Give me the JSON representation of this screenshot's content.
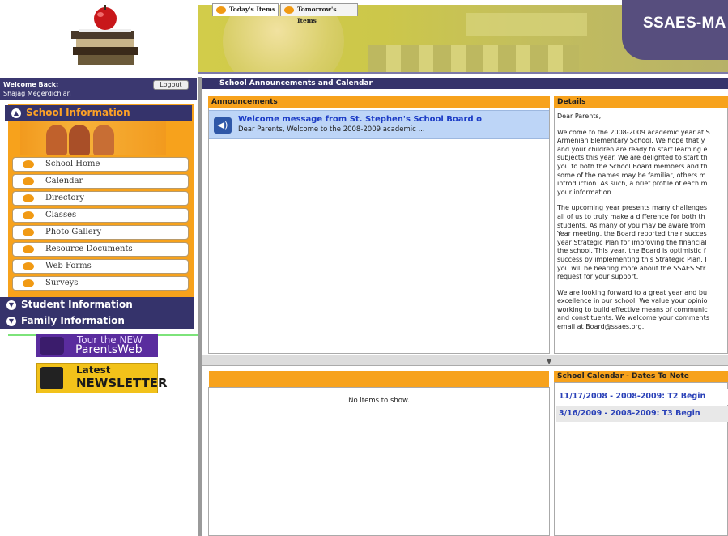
{
  "header": {
    "brand": "SSAES-MA"
  },
  "user": {
    "welcome_label": "Welcome Back:",
    "name": "Shajag Megerdichian",
    "logout_label": "Logout"
  },
  "nav": {
    "sections": [
      {
        "label": "School Information"
      },
      {
        "label": "Student Information"
      },
      {
        "label": "Family Information"
      }
    ],
    "items": [
      {
        "label": "School Home"
      },
      {
        "label": "Calendar"
      },
      {
        "label": "Directory"
      },
      {
        "label": "Classes"
      },
      {
        "label": "Photo Gallery"
      },
      {
        "label": "Resource Documents"
      },
      {
        "label": "Web Forms"
      },
      {
        "label": "Surveys"
      }
    ]
  },
  "promos": {
    "tour": {
      "line1": "Tour the NEW",
      "line2": "ParentsWeb"
    },
    "newsletter": {
      "line1": "Latest",
      "line2": "NEWSLETTER"
    }
  },
  "main": {
    "title": "School Announcements and Calendar",
    "announcements": {
      "header": "Announcements",
      "items": [
        {
          "title": "Welcome message from St. Stephen's School Board o",
          "snippet": "Dear Parents, Welcome to the 2008-2009 academic ..."
        }
      ]
    },
    "details": {
      "header": "Details",
      "paragraphs": [
        [
          "Dear Parents,"
        ],
        [
          "Welcome to the 2008-2009 academic year at S",
          "Armenian Elementary School. We hope that y",
          "and your children are ready to start learning e",
          "subjects this year. We are delighted to start th",
          "you to both the School Board members and th",
          "some of the names may be familiar, others m",
          "introduction. As such, a brief profile of each m",
          "your information."
        ],
        [
          "The upcoming year presents many challenges",
          "all of us to truly make a difference for both th",
          "students. As many of you may be aware from",
          "Year meeting, the Board reported their succes",
          "year Strategic Plan for improving the financial",
          "the school. This year, the Board is optimistic f",
          "success by implementing this Strategic Plan. I",
          "you will be hearing more about the SSAES Str",
          "request for your support."
        ],
        [
          "We are looking forward to a great year and bu",
          "excellence in our school. We value your opinio",
          "working to build effective means of communic",
          "and constituents. We welcome your comments",
          "email at Board@ssaes.org."
        ]
      ]
    },
    "items_tabs": [
      {
        "label": "Today's Items"
      },
      {
        "label": "Tomorrow's Items"
      }
    ],
    "no_items": "No items to show.",
    "calendar": {
      "header": "School Calendar - Dates To Note",
      "entries": [
        {
          "text": "11/17/2008 - 2008-2009: T2 Begin"
        },
        {
          "text": "3/16/2009 - 2008-2009: T3 Begin"
        }
      ]
    }
  },
  "colors": {
    "nav_dark": "#35336b",
    "orange": "#f7a21c",
    "brand_box": "#574e7e",
    "link_blue": "#2a41b8"
  }
}
